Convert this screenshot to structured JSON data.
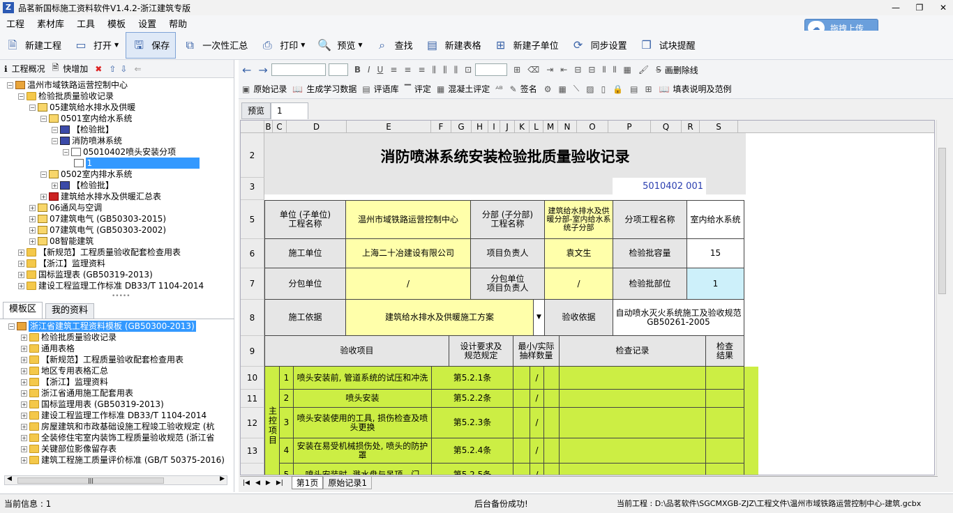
{
  "window": {
    "title": "品茗新国标施工资料软件V1.4.2-浙江建筑专版",
    "min": "—",
    "restore": "❐",
    "close": "✕"
  },
  "menu": [
    "工程",
    "素材库",
    "工具",
    "模板",
    "设置",
    "帮助"
  ],
  "upload_button": "拖拽上传",
  "toolbar": [
    {
      "label": "新建工程",
      "icon": "new-project-icon"
    },
    {
      "label": "打开",
      "icon": "open-icon"
    },
    {
      "label": "保存",
      "icon": "save-icon"
    },
    {
      "label": "一次性汇总",
      "icon": "summary-icon"
    },
    {
      "label": "打印",
      "icon": "print-icon"
    },
    {
      "label": "预览",
      "icon": "preview-icon"
    },
    {
      "label": "查找",
      "icon": "search-icon"
    },
    {
      "label": "新建表格",
      "icon": "new-table-icon"
    },
    {
      "label": "新建子单位",
      "icon": "new-subunit-icon"
    },
    {
      "label": "同步设置",
      "icon": "sync-icon"
    },
    {
      "label": "试块提醒",
      "icon": "reminder-icon"
    }
  ],
  "left_toolbar": {
    "overview": "工程概况",
    "quick_add": "快增加"
  },
  "project_tree": [
    {
      "label": "温州市域铁路运营控制中心",
      "level": 0
    },
    {
      "label": "检验批质量验收记录",
      "level": 1
    },
    {
      "label": "05建筑给水排水及供暖",
      "level": 2
    },
    {
      "label": "0501室内给水系统",
      "level": 3
    },
    {
      "label": "【检验批】",
      "level": 4
    },
    {
      "label": "消防喷淋系统",
      "level": 4
    },
    {
      "label": "05010402喷头安装分项",
      "level": 5
    },
    {
      "label": "1",
      "level": 6
    },
    {
      "label": "0502室内排水系统",
      "level": 3
    },
    {
      "label": "【检验批】",
      "level": 4
    },
    {
      "label": "建筑给水排水及供暖汇总表",
      "level": 3
    },
    {
      "label": "06通风与空调",
      "level": 2
    },
    {
      "label": "07建筑电气 (GB50303-2015)",
      "level": 2
    },
    {
      "label": "07建筑电气 (GB50303-2002)",
      "level": 2
    },
    {
      "label": "08智能建筑",
      "level": 2
    },
    {
      "label": "【新规范】工程质量验收配套检查用表",
      "level": 1
    },
    {
      "label": "【浙江】监理资料",
      "level": 1
    },
    {
      "label": "国标监理表 (GB50319-2013)",
      "level": 1
    },
    {
      "label": "建设工程监理工作标准 DB33/T 1104-2014",
      "level": 1
    }
  ],
  "left_tabs": [
    "模板区",
    "我的资料"
  ],
  "template_tree": [
    "浙江省建筑工程资料模板 (GB50300-2013)",
    "检验批质量验收记录",
    "通用表格",
    "【新规范】工程质量验收配套检查用表",
    "地区专用表格汇总",
    "【浙江】监理资料",
    "浙江省通用施工配套用表",
    "国标监理用表 (GB50319-2013)",
    "建设工程监理工作标准 DB33/T 1104-2014",
    "房屋建筑和市政基础设施工程竣工验收规定 (杭",
    "全装修住宅室内装饰工程质量验收规范 (浙江省",
    "关键部位影像留存表",
    "建筑工程施工质量评价标准 (GB/T 50375-2016)"
  ],
  "format_bar2": [
    "原始记录",
    "生成学习数据",
    "评语库",
    "评定",
    "混凝土评定",
    "签名",
    "填表说明及范例"
  ],
  "strike_label": "画删除线",
  "preview_tab": {
    "label": "预览",
    "value": "1"
  },
  "columns": [
    "B",
    "C",
    "D",
    "E",
    "F",
    "G",
    "H",
    "I",
    "J",
    "K",
    "L",
    "M",
    "N",
    "O",
    "P",
    "Q",
    "R",
    "S"
  ],
  "rows": [
    "2",
    "3",
    "5",
    "6",
    "7",
    "8",
    "9",
    "10",
    "11",
    "12",
    "13"
  ],
  "sheet": {
    "title": "消防喷淋系统安装检验批质量验收记录",
    "code": "5010402 001",
    "unit_label": "单位 (子单位)\n工程名称",
    "unit_value": "温州市域铁路运营控制中心",
    "division_label": "分部 (子分部)\n工程名称",
    "division_value": "建筑给水排水及供暖分部-室内给水系统子分部",
    "subitem_label": "分项工程名称",
    "subitem_value": "室内给水系统",
    "constructor_label": "施工单位",
    "constructor_value": "上海二十冶建设有限公司",
    "pm_label": "项目负责人",
    "pm_value": "袁文生",
    "capacity_label": "检验批容量",
    "capacity_value": "15",
    "subcontractor_label": "分包单位",
    "subcontractor_value": "/",
    "sub_pm_label": "分包单位\n项目负责人",
    "sub_pm_value": "/",
    "part_label": "检验批部位",
    "part_value": "1",
    "basis_label": "施工依据",
    "basis_value": "建筑给水排水及供暖施工方案",
    "accept_label": "验收依据",
    "accept_value": "自动喷水灭火系统施工及验收规范 GB50261-2005",
    "h_item": "验收项目",
    "h_design": "设计要求及\n规范规定",
    "h_sample": "最小/实际\n抽样数量",
    "h_record": "检查记录",
    "h_result": "检查\n结果",
    "main_group": "主控项目",
    "items": [
      {
        "no": "1",
        "text": "喷头安装前, 管道系统的试压和冲洗",
        "spec": "第5.2.1条",
        "sample": "/"
      },
      {
        "no": "2",
        "text": "喷头安装",
        "spec": "第5.2.2条",
        "sample": "/"
      },
      {
        "no": "3",
        "text": "喷头安装使用的工具, 损伤检查及喷头更换",
        "spec": "第5.2.3条",
        "sample": "/"
      },
      {
        "no": "4",
        "text": "安装在易受机械损伤处, 喷头的防护罩",
        "spec": "第5.2.4条",
        "sample": "/"
      },
      {
        "no": "5",
        "text": "喷头安装时, 溅水盘与吊顶、门",
        "spec": "第5.2.5条",
        "sample": "/"
      }
    ]
  },
  "sheet_tabs": [
    "第1页",
    "原始记录1"
  ],
  "status": {
    "info": "当前信息 : 1",
    "backup": "后台备份成功!",
    "project": "当前工程 : D:\\品茗软件\\SGCMXGB-ZJZ\\工程文件\\温州市域铁路运营控制中心-建筑.gcbx"
  }
}
